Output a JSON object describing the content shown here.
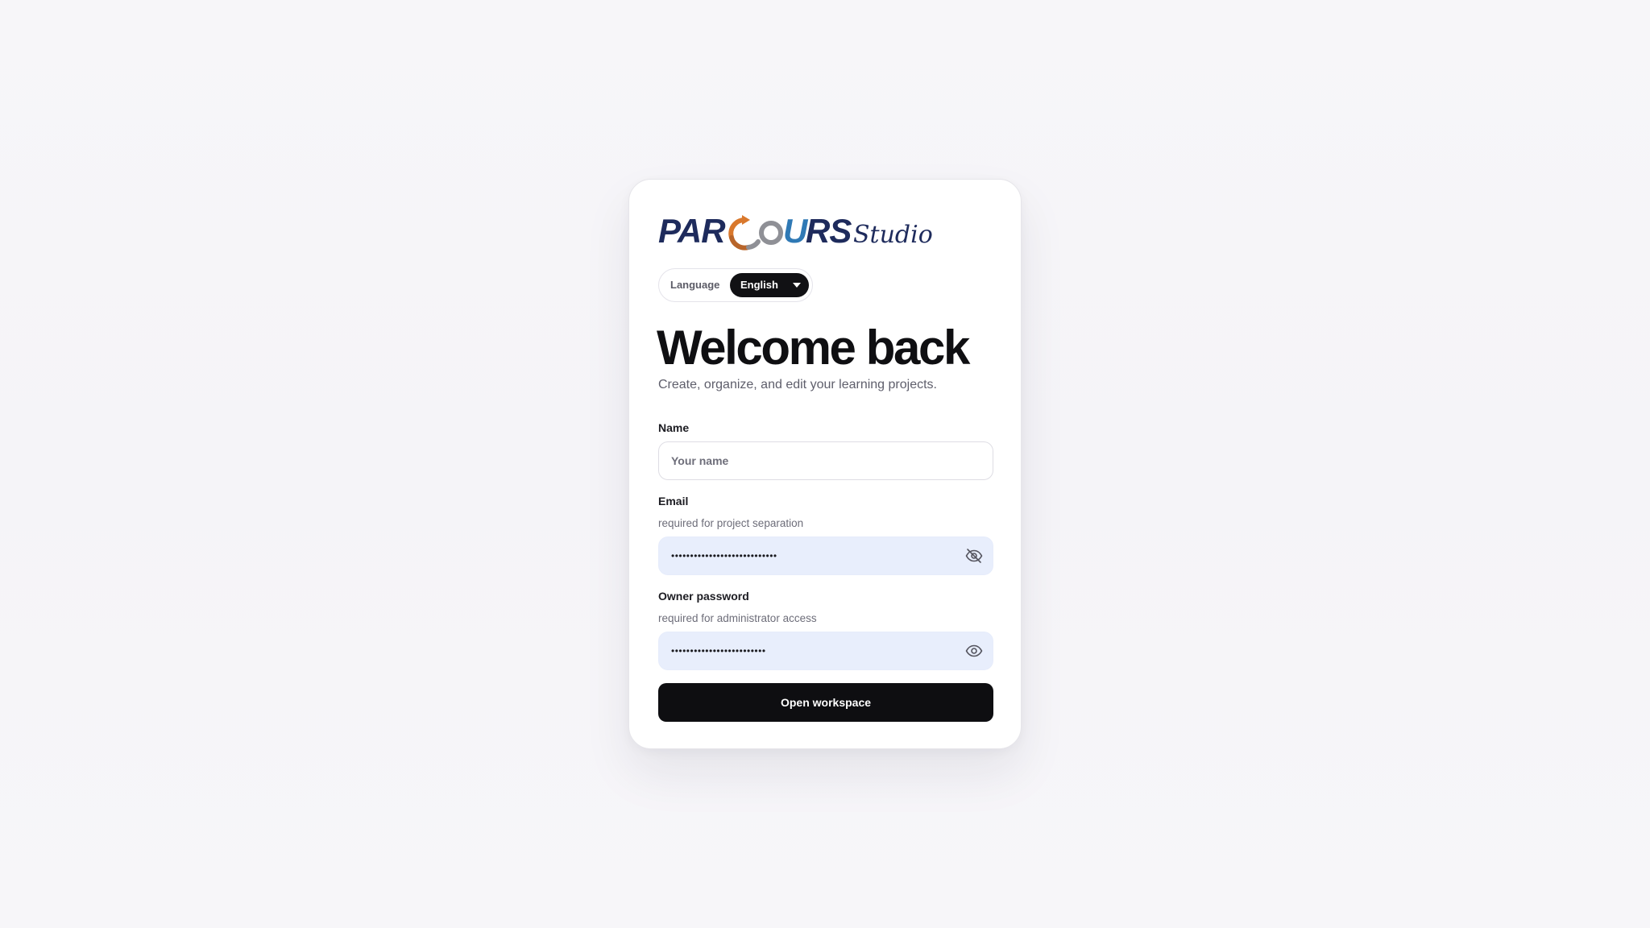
{
  "brand": {
    "logo_text": "PARCOURS",
    "logo_suffix": "Studio",
    "colors": {
      "navy": "#1e2b5c",
      "ring_orange": "#d9782c",
      "ring_gray": "#8f9096",
      "ring_blue": "#2f79b5"
    }
  },
  "language": {
    "label": "Language",
    "selected": "English",
    "icon": "chevron-down-icon"
  },
  "header": {
    "title": "Welcome back",
    "subtitle": "Create, organize, and edit your learning projects."
  },
  "form": {
    "name": {
      "label": "Name",
      "placeholder": "Your name",
      "value": ""
    },
    "email": {
      "label": "Email",
      "help": "required for project separation",
      "value": "••••••••••••••••••••••••••••",
      "icon": "eye-off-icon"
    },
    "owner_password": {
      "label": "Owner password",
      "help": "required for administrator access",
      "value": "•••••••••••••••••••••••••",
      "icon": "eye-icon"
    },
    "submit_label": "Open workspace"
  },
  "colors": {
    "primary_button": "#0e0e11",
    "autofill_bg": "#e8eefc",
    "page_bg": "#f6f5f8"
  }
}
